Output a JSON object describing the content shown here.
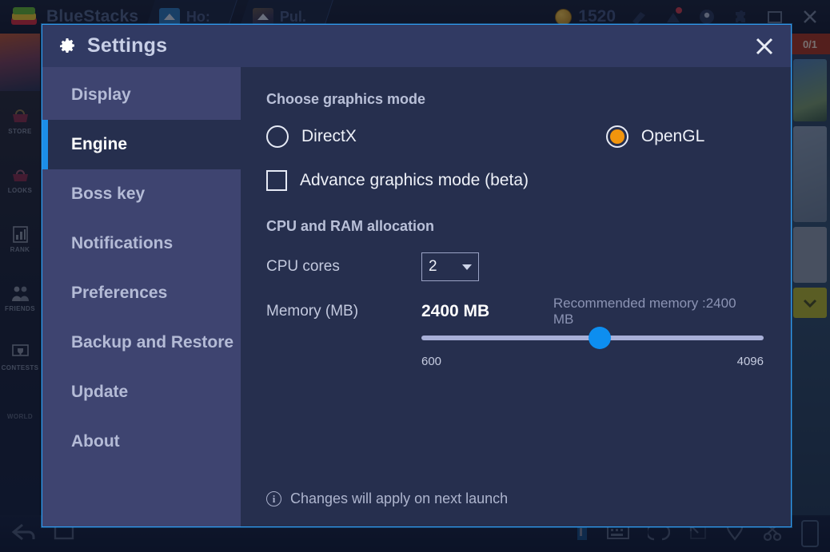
{
  "background": {
    "brand": "BlueStacks",
    "tabs": [
      {
        "label": "Ho:",
        "icon": "home-icon"
      },
      {
        "label": "Pul.",
        "icon": "game-avatar-icon"
      }
    ],
    "coin_count": "1520",
    "top_icons": [
      "brush-icon",
      "notification-icon",
      "record-icon",
      "puzzle-icon",
      "maximize-icon",
      "close-icon"
    ],
    "game_rail": [
      {
        "label": "STORE",
        "icon": "store-basket-icon"
      },
      {
        "label": "LOOKS",
        "icon": "handbag-icon"
      },
      {
        "label": "RANK",
        "icon": "rank-chart-icon"
      },
      {
        "label": "FRIENDS",
        "icon": "friends-icon"
      },
      {
        "label": "CONTESTS",
        "icon": "trophy-banner-icon"
      },
      {
        "label": "WORLD",
        "icon": "world-icon"
      }
    ],
    "right_panel": {
      "banner": "0/1"
    },
    "bottom_icons": [
      "back-arrow-icon",
      "home-square-icon",
      "sidebar-toggle-icon",
      "keyboard-icon",
      "gesture-icon",
      "fullscreen-icon",
      "location-icon",
      "scissors-icon",
      "phone-icon"
    ]
  },
  "dialog": {
    "title": "Settings",
    "title_icon": "gear-icon",
    "close_icon": "close-icon",
    "sidebar": {
      "items": [
        {
          "label": "Display",
          "active": false
        },
        {
          "label": "Engine",
          "active": true
        },
        {
          "label": "Boss key",
          "active": false
        },
        {
          "label": "Notifications",
          "active": false
        },
        {
          "label": "Preferences",
          "active": false
        },
        {
          "label": "Backup and Restore",
          "active": false
        },
        {
          "label": "Update",
          "active": false
        },
        {
          "label": "About",
          "active": false
        }
      ]
    },
    "engine": {
      "graphics_heading": "Choose graphics mode",
      "graphics_options": [
        {
          "label": "DirectX",
          "selected": false
        },
        {
          "label": "OpenGL",
          "selected": true
        }
      ],
      "advance_mode": {
        "label": "Advance graphics mode (beta)",
        "checked": false
      },
      "allocation_heading": "CPU and RAM allocation",
      "cpu_cores_label": "CPU cores",
      "cpu_cores_value": "2",
      "memory_label": "Memory (MB)",
      "memory_value": "2400 MB",
      "memory_recommended": "Recommended memory :2400 MB",
      "slider_min": "600",
      "slider_max": "4096",
      "slider_percent": 52
    },
    "footer_note": "Changes will apply on next launch",
    "footer_icon": "info-icon"
  },
  "colors": {
    "accent_blue": "#1c8ee8",
    "radio_orange": "#f2950d",
    "dialog_border": "#2f9cf0",
    "titlebar": "#313a63",
    "sidebar": "#3e4470",
    "content": "#262f4e",
    "slider_track": "#a8b0d8",
    "slider_thumb": "#0d8ef0"
  }
}
